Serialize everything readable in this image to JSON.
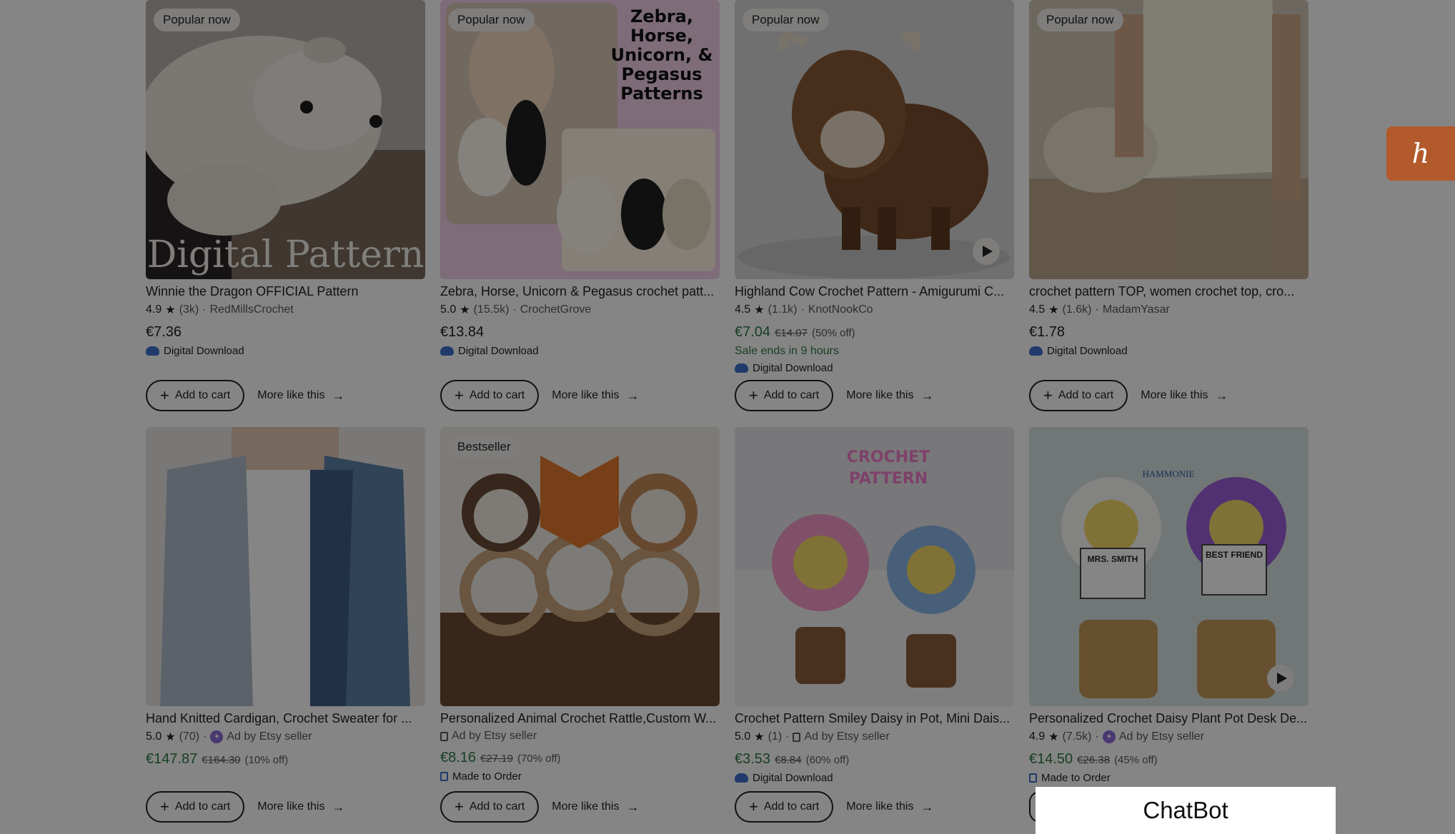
{
  "listings": [
    {
      "badge": "Popular now",
      "title": "Winnie the Dragon OFFICIAL Pattern",
      "rating": "4.9",
      "reviews": "(3k)",
      "seller": "RedMillsCrochet",
      "price": "€7.36",
      "tag": "Digital Download",
      "cart_label": "Add to cart",
      "more_label": "More like this",
      "image_text": "Digital Pattern",
      "colors": [
        "#c9c2bd",
        "#e8e2db",
        "#2c2a2a"
      ]
    },
    {
      "badge": "Popular now",
      "title": "Zebra, Horse, Unicorn & Pegasus crochet patt...",
      "rating": "5.0",
      "reviews": "(15.5k)",
      "seller": "CrochetGrove",
      "price": "€13.84",
      "tag": "Digital Download",
      "cart_label": "Add to cart",
      "more_label": "More like this",
      "image_text": "Zebra, Horse, Unicorn, & Pegasus Patterns",
      "colors": [
        "#f2d6ee",
        "#f6f1e6",
        "#222222"
      ]
    },
    {
      "badge": "Popular now",
      "title": "Highland Cow Crochet Pattern - Amigurumi C...",
      "rating": "4.5",
      "reviews": "(1.1k)",
      "seller": "KnotNookCo",
      "price": "€7.04",
      "original_price": "€14.07",
      "discount": "(50% off)",
      "sale_ends": "Sale ends in 9 hours",
      "tag": "Digital Download",
      "cart_label": "Add to cart",
      "more_label": "More like this",
      "colors": [
        "#d9d9d9",
        "#8a5a34",
        "#ffffff"
      ]
    },
    {
      "badge": "Popular now",
      "title": "crochet pattern TOP, women crochet top, cro...",
      "rating": "4.5",
      "reviews": "(1.6k)",
      "seller": "MadamYasar",
      "price": "€1.78",
      "tag": "Digital Download",
      "cart_label": "Add to cart",
      "more_label": "More like this",
      "colors": [
        "#e4dcc9",
        "#f4efdb",
        "#b89070"
      ]
    },
    {
      "title": "Hand Knitted Cardigan, Crochet Sweater for ...",
      "rating": "5.0",
      "reviews": "(70)",
      "seller": "Ad by Etsy seller",
      "price": "€147.87",
      "original_price": "€164.30",
      "discount": "(10% off)",
      "cart_label": "Add to cart",
      "more_label": "More like this",
      "colors": [
        "#e9e8e4",
        "#4a6f9a",
        "#ffffff"
      ]
    },
    {
      "badge": "Bestseller",
      "title": "Personalized Animal Crochet Rattle,Custom W...",
      "seller": "Ad by Etsy seller",
      "price": "€8.16",
      "original_price": "€27.19",
      "discount": "(70% off)",
      "tag": "Made to Order",
      "cart_label": "Add to cart",
      "more_label": "More like this",
      "colors": [
        "#6b4a32",
        "#f0ece6",
        "#e47a2e"
      ]
    },
    {
      "title": "Crochet Pattern Smiley Daisy in Pot, Mini Dais...",
      "rating": "5.0",
      "reviews": "(1)",
      "seller": "Ad by Etsy seller",
      "price": "€3.53",
      "original_price": "€8.84",
      "discount": "(60% off)",
      "tag": "Digital Download",
      "cart_label": "Add to cart",
      "more_label": "More like this",
      "image_text": "CROCHET PATTERN",
      "colors": [
        "#e8e7ea",
        "#f49ac7",
        "#8ab6e8"
      ]
    },
    {
      "title": "Personalized Crochet Daisy Plant Pot Desk De...",
      "rating": "4.9",
      "reviews": "(7.5k)",
      "seller": "Ad by Etsy seller",
      "price": "€14.50",
      "original_price": "€26.38",
      "discount": "(45% off)",
      "tag": "Made to Order",
      "image_text_1": "MRS. SMITH",
      "image_text_2": "BEST FRIEND",
      "image_text_3": "HAMMONIE",
      "colors": [
        "#d9e4e3",
        "#c69a5b",
        "#9b5fd8"
      ]
    }
  ],
  "side_tab": {
    "label": "h"
  },
  "chatbot": {
    "label": "ChatBot"
  }
}
